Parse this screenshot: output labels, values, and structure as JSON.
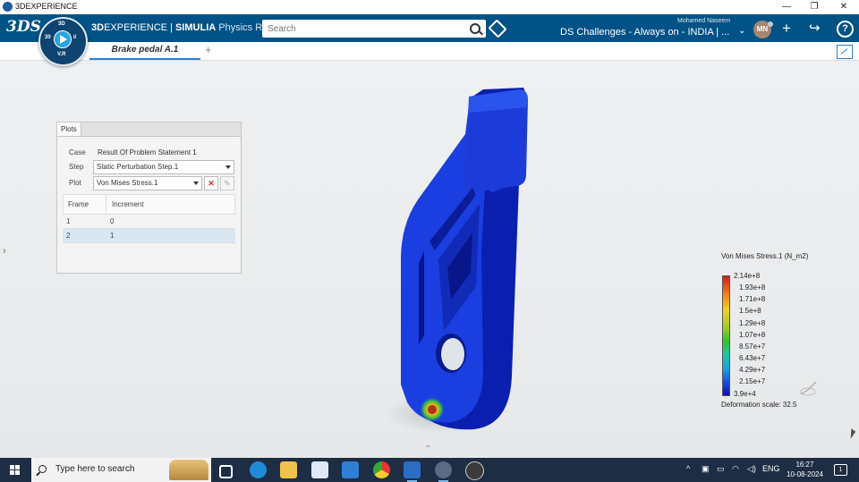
{
  "window": {
    "title": "3DEXPERIENCE",
    "minimize": "—",
    "restore": "❐",
    "close": "✕"
  },
  "topbar": {
    "logo": "3DS",
    "compass": {
      "top": "3D",
      "right": "i/",
      "left": "30",
      "bottom": "V.R"
    },
    "brand_3d": "3D",
    "brand_experience": "EXPERIENCE",
    "brand_sep": " | ",
    "brand_product": "SIMULIA",
    "brand_app": " Physics R...",
    "search_placeholder": "Search",
    "user_name": "Mohamed Naseem",
    "collab_space": "DS Challenges - Always on - INDIA | ...",
    "avatar_initials": "MN",
    "icons": [
      "tag-icon",
      "chevron-down-icon",
      "plus-icon",
      "share-icon",
      "help-icon"
    ]
  },
  "tabs": {
    "active": "Brake pedal A.1",
    "add": "+"
  },
  "plots_panel": {
    "tab": "Plots",
    "case_label": "Case",
    "case_value": "Result Of Problem Statement 1",
    "step_label": "Step",
    "step_value": "Static Perturbation Step.1",
    "plot_label": "Plot",
    "plot_value": "Von Mises Stress.1",
    "columns": [
      "Frame",
      "Increment"
    ],
    "rows": [
      {
        "frame": "1",
        "increment": "0"
      },
      {
        "frame": "2",
        "increment": "1"
      }
    ],
    "selected_row": 2
  },
  "legend": {
    "title": "Von Mises Stress.1 (N_m2)",
    "labels": [
      "2.14e+8",
      "1.93e+8",
      "1.71e+8",
      "1.5e+8",
      "1.29e+8",
      "1.07e+8",
      "8.57e+7",
      "6.43e+7",
      "4.29e+7",
      "2.15e+7",
      "3.9e+4"
    ],
    "deformation": "Deformation scale: 32.5"
  },
  "taskbar": {
    "search_placeholder": "Type here to search",
    "language": "ENG",
    "time": "16:27",
    "date": "10-08-2024",
    "notifications": "1",
    "apps": [
      "task-view-icon",
      "edge-icon",
      "file-explorer-icon",
      "store-icon",
      "mail-icon",
      "chrome-icon",
      "word-icon",
      "3dexperience-icon",
      "obs-icon"
    ]
  },
  "colors": {
    "topbar": "#005386",
    "accent": "#2b7fd2",
    "taskbar": "#1d2d44",
    "model_blue": "#1438d0"
  }
}
